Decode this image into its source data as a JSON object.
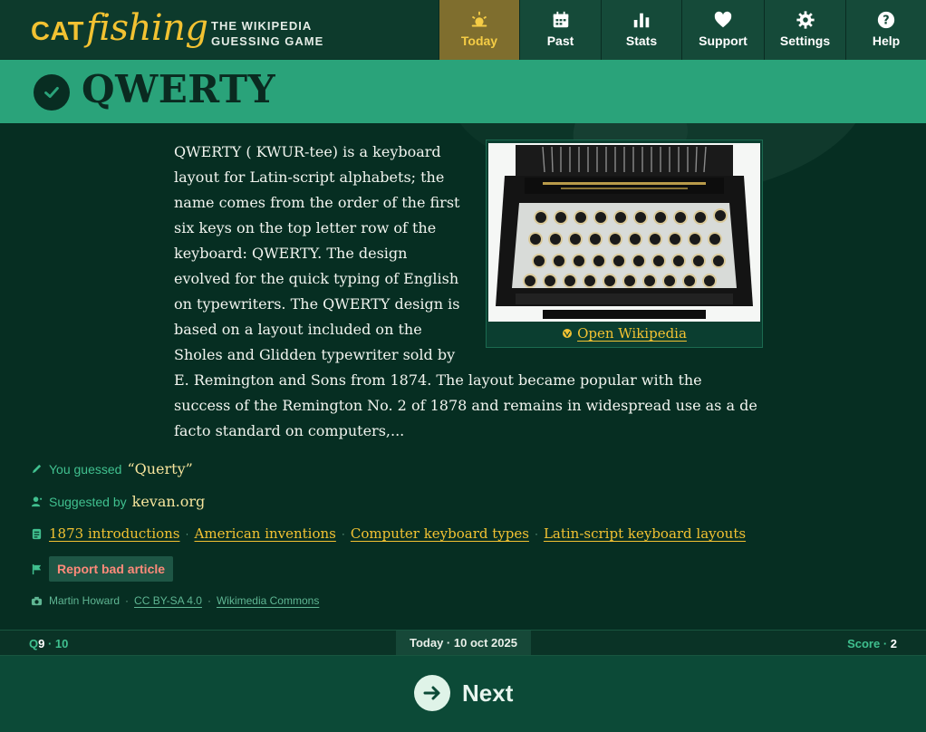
{
  "logo": {
    "cat": "CAT",
    "fishing": "fishing"
  },
  "tagline": {
    "line1": "THE WIKIPEDIA",
    "line2": "GUESSING GAME"
  },
  "nav": [
    {
      "label": "Today",
      "icon": "sunrise-icon",
      "active": true
    },
    {
      "label": "Past",
      "icon": "calendar-icon"
    },
    {
      "label": "Stats",
      "icon": "bar-chart-icon"
    },
    {
      "label": "Support",
      "icon": "heart-icon"
    },
    {
      "label": "Settings",
      "icon": "gear-icon"
    },
    {
      "label": "Help",
      "icon": "question-icon"
    }
  ],
  "title": "QWERTY",
  "article": {
    "text": "QWERTY ( KWUR-tee) is a keyboard layout for Latin-script alphabets; the name comes from the order of the first six keys on the top letter row of the keyboard: QWERTY. The design evolved for the quick typing of English on typewriters. The QWERTY design is based on a layout included on the Sholes and Glidden typewriter sold by E. Remington and Sons from 1874. The layout became popular with the success of the Remington No. 2 of 1878 and remains in widespread use as a de facto standard on computers,...",
    "image_alt": "Remington standard typewriter",
    "open_wikipedia": "Open Wikipedia"
  },
  "guess": {
    "label": "You guessed",
    "value": "“Querty”"
  },
  "suggested": {
    "label": "Suggested by",
    "value": "kevan.org"
  },
  "categories": [
    "1873 introductions",
    "American inventions",
    "Computer keyboard types",
    "Latin-script keyboard layouts"
  ],
  "report": "Report bad article",
  "credit": {
    "author": "Martin Howard",
    "license": "CC BY-SA 4.0",
    "source": "Wikimedia Commons"
  },
  "status": {
    "q_prefix": "Q",
    "q_current": "9",
    "q_total": "10",
    "date": "Today · 10 oct 2025",
    "score_label": "Score",
    "score_value": "2"
  },
  "next": "Next",
  "colors": {
    "accent": "#f2c232",
    "band": "#2aa37a",
    "background": "#062e22",
    "report": "#ff8a7a"
  }
}
